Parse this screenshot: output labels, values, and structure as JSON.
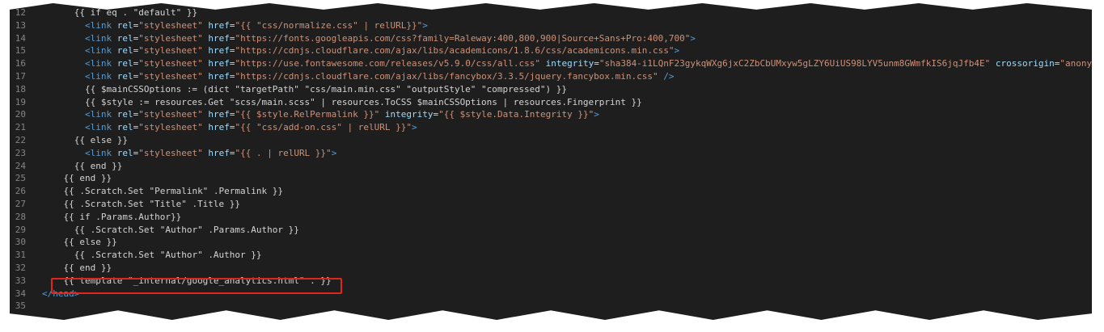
{
  "editor": {
    "lines": [
      {
        "n": "12",
        "indent": "      ",
        "parts": [
          {
            "c": "tpl",
            "t": "{{ if eq . \"default\" }}"
          }
        ]
      },
      {
        "n": "13",
        "indent": "        ",
        "parts": [
          {
            "c": "tag",
            "t": "<link"
          },
          {
            "c": "tpl",
            "t": " "
          },
          {
            "c": "attr",
            "t": "rel"
          },
          {
            "c": "tpl",
            "t": "="
          },
          {
            "c": "str",
            "t": "\"stylesheet\""
          },
          {
            "c": "tpl",
            "t": " "
          },
          {
            "c": "attr",
            "t": "href"
          },
          {
            "c": "tpl",
            "t": "="
          },
          {
            "c": "str",
            "t": "\"{{ \"css/normalize.css\" | relURL}}\""
          },
          {
            "c": "tag",
            "t": ">"
          }
        ]
      },
      {
        "n": "14",
        "indent": "        ",
        "parts": [
          {
            "c": "tag",
            "t": "<link"
          },
          {
            "c": "tpl",
            "t": " "
          },
          {
            "c": "attr",
            "t": "rel"
          },
          {
            "c": "tpl",
            "t": "="
          },
          {
            "c": "str",
            "t": "\"stylesheet\""
          },
          {
            "c": "tpl",
            "t": " "
          },
          {
            "c": "attr",
            "t": "href"
          },
          {
            "c": "tpl",
            "t": "="
          },
          {
            "c": "str",
            "t": "\"https://fonts.googleapis.com/css?family=Raleway:400,800,900|Source+Sans+Pro:400,700\""
          },
          {
            "c": "tag",
            "t": ">"
          }
        ]
      },
      {
        "n": "15",
        "indent": "        ",
        "parts": [
          {
            "c": "tag",
            "t": "<link"
          },
          {
            "c": "tpl",
            "t": " "
          },
          {
            "c": "attr",
            "t": "rel"
          },
          {
            "c": "tpl",
            "t": "="
          },
          {
            "c": "str",
            "t": "\"stylesheet\""
          },
          {
            "c": "tpl",
            "t": " "
          },
          {
            "c": "attr",
            "t": "href"
          },
          {
            "c": "tpl",
            "t": "="
          },
          {
            "c": "str",
            "t": "\"https://cdnjs.cloudflare.com/ajax/libs/academicons/1.8.6/css/academicons.min.css\""
          },
          {
            "c": "tag",
            "t": ">"
          }
        ]
      },
      {
        "n": "16",
        "indent": "        ",
        "parts": [
          {
            "c": "tag",
            "t": "<link"
          },
          {
            "c": "tpl",
            "t": " "
          },
          {
            "c": "attr",
            "t": "rel"
          },
          {
            "c": "tpl",
            "t": "="
          },
          {
            "c": "str",
            "t": "\"stylesheet\""
          },
          {
            "c": "tpl",
            "t": " "
          },
          {
            "c": "attr",
            "t": "href"
          },
          {
            "c": "tpl",
            "t": "="
          },
          {
            "c": "str",
            "t": "\"https://use.fontawesome.com/releases/v5.9.0/css/all.css\""
          },
          {
            "c": "tpl",
            "t": " "
          },
          {
            "c": "attr",
            "t": "integrity"
          },
          {
            "c": "tpl",
            "t": "="
          },
          {
            "c": "str",
            "t": "\"sha384-i1LQnF23gykqWXg6jxC2ZbCbUMxyw5gLZY6UiUS98LYV5unm8GWmfkIS6jqJfb4E\""
          },
          {
            "c": "tpl",
            "t": " "
          },
          {
            "c": "attr",
            "t": "crossorigin"
          },
          {
            "c": "tpl",
            "t": "="
          },
          {
            "c": "str",
            "t": "\"anonymous\""
          },
          {
            "c": "tag",
            "t": ">"
          }
        ]
      },
      {
        "n": "17",
        "indent": "        ",
        "parts": [
          {
            "c": "tag",
            "t": "<link"
          },
          {
            "c": "tpl",
            "t": " "
          },
          {
            "c": "attr",
            "t": "rel"
          },
          {
            "c": "tpl",
            "t": "="
          },
          {
            "c": "str",
            "t": "\"stylesheet\""
          },
          {
            "c": "tpl",
            "t": " "
          },
          {
            "c": "attr",
            "t": "href"
          },
          {
            "c": "tpl",
            "t": "="
          },
          {
            "c": "str",
            "t": "\"https://cdnjs.cloudflare.com/ajax/libs/fancybox/3.3.5/jquery.fancybox.min.css\""
          },
          {
            "c": "tpl",
            "t": " "
          },
          {
            "c": "tag",
            "t": "/>"
          }
        ]
      },
      {
        "n": "18",
        "indent": "        ",
        "parts": [
          {
            "c": "tpl",
            "t": "{{ $mainCSSOptions := (dict \"targetPath\" \"css/main.min.css\" \"outputStyle\" \"compressed\") }}"
          }
        ]
      },
      {
        "n": "19",
        "indent": "        ",
        "parts": [
          {
            "c": "tpl",
            "t": "{{ $style := resources.Get \"scss/main.scss\" | resources.ToCSS $mainCSSOptions | resources.Fingerprint }}"
          }
        ]
      },
      {
        "n": "20",
        "indent": "        ",
        "parts": [
          {
            "c": "tag",
            "t": "<link"
          },
          {
            "c": "tpl",
            "t": " "
          },
          {
            "c": "attr",
            "t": "rel"
          },
          {
            "c": "tpl",
            "t": "="
          },
          {
            "c": "str",
            "t": "\"stylesheet\""
          },
          {
            "c": "tpl",
            "t": " "
          },
          {
            "c": "attr",
            "t": "href"
          },
          {
            "c": "tpl",
            "t": "="
          },
          {
            "c": "str",
            "t": "\"{{ $style.RelPermalink }}\""
          },
          {
            "c": "tpl",
            "t": " "
          },
          {
            "c": "attr",
            "t": "integrity"
          },
          {
            "c": "tpl",
            "t": "="
          },
          {
            "c": "str",
            "t": "\"{{ $style.Data.Integrity }}\""
          },
          {
            "c": "tag",
            "t": ">"
          }
        ]
      },
      {
        "n": "21",
        "indent": "        ",
        "parts": [
          {
            "c": "tag",
            "t": "<link"
          },
          {
            "c": "tpl",
            "t": " "
          },
          {
            "c": "attr",
            "t": "rel"
          },
          {
            "c": "tpl",
            "t": "="
          },
          {
            "c": "str",
            "t": "\"stylesheet\""
          },
          {
            "c": "tpl",
            "t": " "
          },
          {
            "c": "attr",
            "t": "href"
          },
          {
            "c": "tpl",
            "t": "="
          },
          {
            "c": "str",
            "t": "\"{{ \"css/add-on.css\" | relURL }}\""
          },
          {
            "c": "tag",
            "t": ">"
          }
        ]
      },
      {
        "n": "22",
        "indent": "      ",
        "parts": [
          {
            "c": "tpl",
            "t": "{{ else }}"
          }
        ]
      },
      {
        "n": "23",
        "indent": "        ",
        "parts": [
          {
            "c": "tag",
            "t": "<link"
          },
          {
            "c": "tpl",
            "t": " "
          },
          {
            "c": "attr",
            "t": "rel"
          },
          {
            "c": "tpl",
            "t": "="
          },
          {
            "c": "str",
            "t": "\"stylesheet\""
          },
          {
            "c": "tpl",
            "t": " "
          },
          {
            "c": "attr",
            "t": "href"
          },
          {
            "c": "tpl",
            "t": "="
          },
          {
            "c": "str",
            "t": "\"{{ . | relURL }}\""
          },
          {
            "c": "tag",
            "t": ">"
          }
        ]
      },
      {
        "n": "24",
        "indent": "      ",
        "parts": [
          {
            "c": "tpl",
            "t": "{{ end }}"
          }
        ]
      },
      {
        "n": "25",
        "indent": "    ",
        "parts": [
          {
            "c": "tpl",
            "t": "{{ end }}"
          }
        ]
      },
      {
        "n": "26",
        "indent": "    ",
        "parts": [
          {
            "c": "tpl",
            "t": "{{ .Scratch.Set \"Permalink\" .Permalink }}"
          }
        ]
      },
      {
        "n": "27",
        "indent": "    ",
        "parts": [
          {
            "c": "tpl",
            "t": "{{ .Scratch.Set \"Title\" .Title }}"
          }
        ]
      },
      {
        "n": "28",
        "indent": "    ",
        "parts": [
          {
            "c": "tpl",
            "t": "{{ if .Params.Author}}"
          }
        ]
      },
      {
        "n": "29",
        "indent": "      ",
        "parts": [
          {
            "c": "tpl",
            "t": "{{ .Scratch.Set \"Author\" .Params.Author }}"
          }
        ]
      },
      {
        "n": "30",
        "indent": "    ",
        "parts": [
          {
            "c": "tpl",
            "t": "{{ else }}"
          }
        ]
      },
      {
        "n": "31",
        "indent": "      ",
        "parts": [
          {
            "c": "tpl",
            "t": "{{ .Scratch.Set \"Author\" .Author }}"
          }
        ]
      },
      {
        "n": "32",
        "indent": "    ",
        "parts": [
          {
            "c": "tpl",
            "t": "{{ end }}"
          }
        ]
      },
      {
        "n": "33",
        "indent": "    ",
        "parts": [
          {
            "c": "tpl",
            "t": "{{ template \"_internal/google_analytics.html\" . }}"
          }
        ]
      },
      {
        "n": "34",
        "indent": "",
        "parts": [
          {
            "c": "tag",
            "t": "</head>"
          }
        ]
      },
      {
        "n": "35",
        "indent": "",
        "parts": []
      }
    ]
  },
  "colors": {
    "background": "#1e1e1e",
    "line_number": "#858585",
    "tag": "#569cd6",
    "attribute": "#9cdcfe",
    "string": "#ce9178",
    "text": "#d4d4d4",
    "highlight_border": "#e0261b"
  }
}
